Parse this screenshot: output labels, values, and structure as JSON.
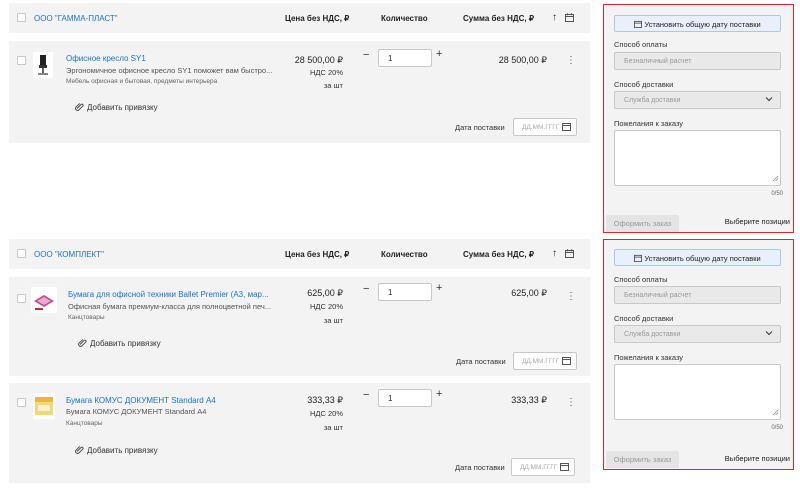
{
  "columns": {
    "price": "Цена без НДС, ₽",
    "quantity": "Количество",
    "sum": "Сумма без НДС, ₽"
  },
  "icons": {
    "sort": "arrow-up-icon",
    "calendar": "calendar-icon",
    "more": "kebab-icon",
    "attach": "paperclip-icon",
    "select": "chevron-down-icon"
  },
  "colors": {
    "link": "#1a73c8",
    "panel_border": "#d9282f",
    "set_date_bg": "#e8f1fb"
  },
  "groups": [
    {
      "supplier": "ООО \"ГАММА-ПЛАСТ\"",
      "sort_glyph": "↑",
      "products": [
        {
          "name": "Офисное кресло SY1",
          "desc": "Эргономичное офисное кресло SY1 поможет вам быстро...",
          "category": "Мебель офисная и бытовая, предметы интерьера",
          "price": "28 500,00 ₽",
          "vat": "НДС 20%",
          "unit": "за шт",
          "qty": "1",
          "sum": "28 500,00 ₽",
          "add_link": "Добавить привязку",
          "date_label": "Дата поставки",
          "date_placeholder": "ДД.ММ.ГГГГ"
        }
      ],
      "panel": {
        "set_date": "Установить общую дату поставки",
        "payment_label": "Способ оплаты",
        "payment_value": "Безналичный расчет",
        "delivery_label": "Способ доставки",
        "delivery_value": "Служба доставки",
        "wishes_label": "Пожелания к заказу",
        "counter": "0/50",
        "order_button": "Оформить заказ",
        "choose_hint": "Выберите позиции"
      }
    },
    {
      "supplier": "ООО \"КОМПЛЕКТ\"",
      "sort_glyph": "↑",
      "products": [
        {
          "name": "Бумага для офисной техники Ballet Premier (А3, мар...",
          "desc": "Офисная бумага премиум-класса для полноцветной печ...",
          "category": "Канцтовары",
          "price": "625,00 ₽",
          "vat": "НДС 20%",
          "unit": "за шт",
          "qty": "1",
          "sum": "625,00 ₽",
          "add_link": "Добавить привязку",
          "date_label": "Дата поставки",
          "date_placeholder": "ДД.ММ.ГГГГ"
        },
        {
          "name": "Бумага КОМУС ДОКУМЕНТ Standard А4",
          "desc": "Бумага КОМУС ДОКУМЕНТ Standard А4",
          "category": "Канцтовары",
          "price": "333,33 ₽",
          "vat": "НДС 20%",
          "unit": "за шт",
          "qty": "1",
          "sum": "333,33 ₽",
          "add_link": "Добавить привязку",
          "date_label": "Дата поставки",
          "date_placeholder": "ДД.ММ.ГГГГ"
        }
      ],
      "panel": {
        "set_date": "Установить общую дату поставки",
        "payment_label": "Способ оплаты",
        "payment_value": "Безналичный расчет",
        "delivery_label": "Способ доставки",
        "delivery_value": "Служба доставки",
        "wishes_label": "Пожелания к заказу",
        "counter": "0/50",
        "order_button": "Оформить заказ",
        "choose_hint": "Выберите позиции"
      }
    }
  ]
}
